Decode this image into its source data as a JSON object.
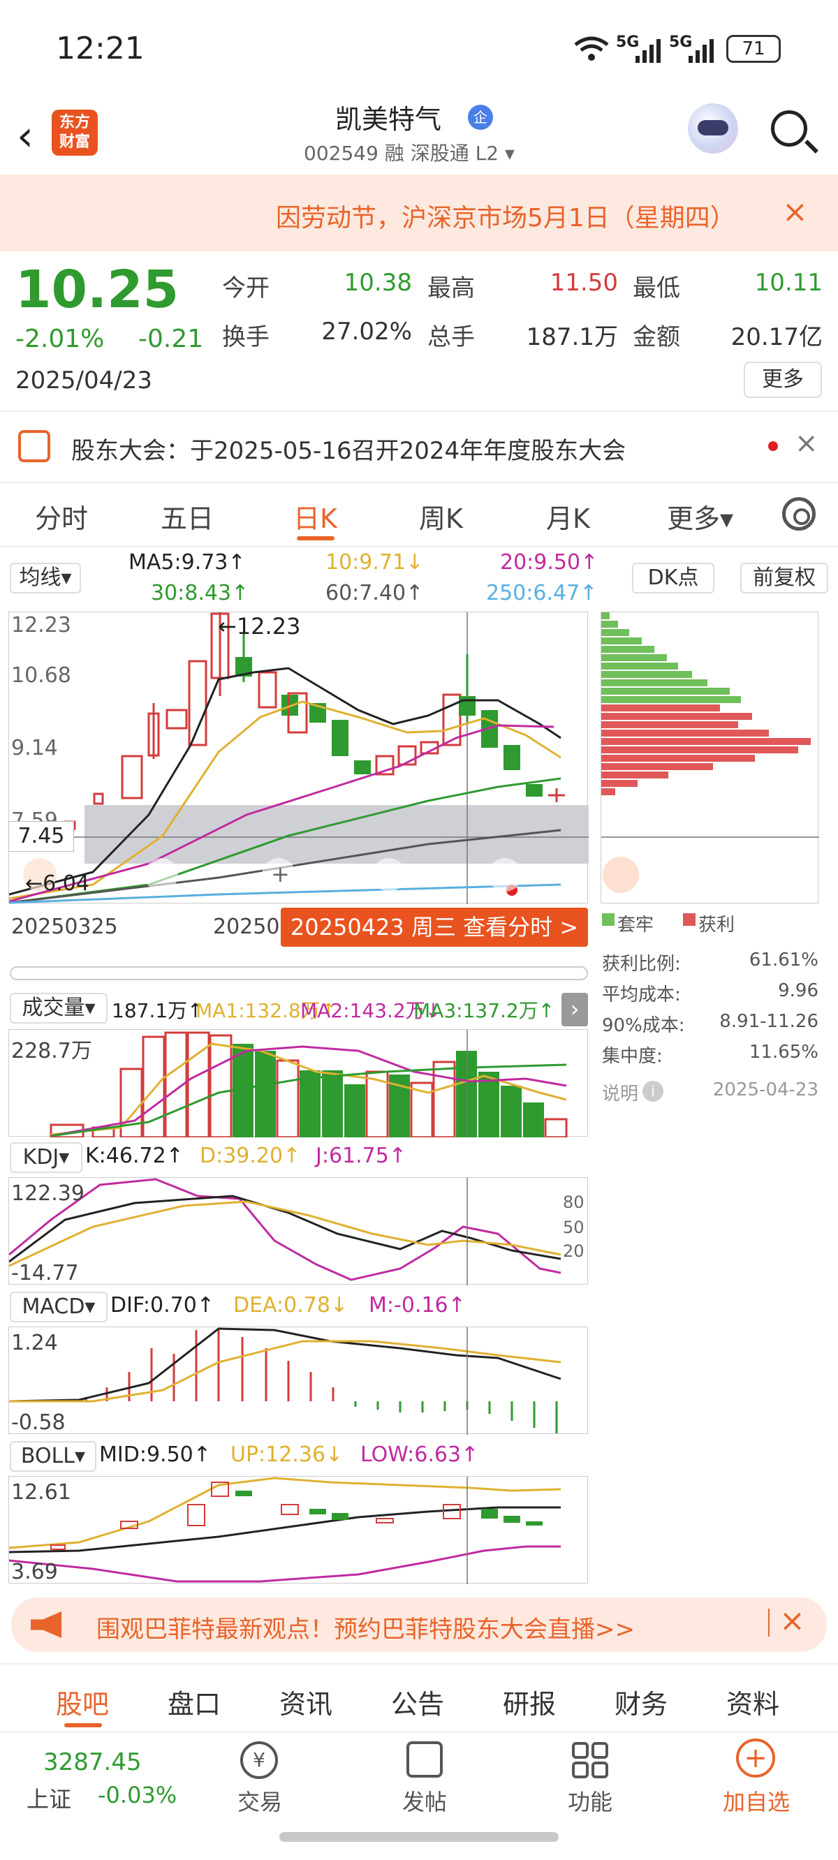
{
  "status": {
    "time": "12:21",
    "net1": "5G",
    "net2": "5G",
    "battery": "71"
  },
  "header": {
    "logo": "东方\n财富",
    "name": "凯美特气",
    "badge": "企",
    "sub": "002549 融 深股通 L2 ▾"
  },
  "notice": {
    "text": "因劳动节，沪深京市场5月1日（星期四）",
    "close": "×"
  },
  "quote": {
    "price": "10.25",
    "pct": "-2.01%",
    "chg": "-0.21",
    "date": "2025/04/23",
    "open_l": "今开",
    "open": "10.38",
    "high_l": "最高",
    "high": "11.50",
    "low_l": "最低",
    "low": "10.11",
    "turn_l": "换手",
    "turn": "27.02%",
    "vol_l": "总手",
    "vol": "187.1万",
    "amt_l": "金额",
    "amt": "20.17亿",
    "more": "更多"
  },
  "meeting": {
    "text": "股东大会：于2025-05-16召开2024年年度股东大会",
    "close": "×"
  },
  "ktabs": [
    "分时",
    "五日",
    "日K",
    "周K",
    "月K",
    "更多▾"
  ],
  "ma": {
    "btn": "均线▾",
    "ma5": "MA5:9.73↑",
    "ma10": "10:9.71↓",
    "ma20": "20:9.50↑",
    "ma30": "30:8.43↑",
    "ma60": "60:7.40↑",
    "ma250": "250:6.47↑",
    "dk": "DK点",
    "fq": "前复权"
  },
  "kchart": {
    "y1": "12.23",
    "y2": "10.68",
    "y3": "9.14",
    "y4": "7.59",
    "y5": "6.04",
    "max_label": "←12.23",
    "cross": "7.45",
    "min_label": "←6.04",
    "d1": "20250325",
    "d2": "20250",
    "tip": "20250423 周三 查看分时 >"
  },
  "chips": {
    "legend1": "套牢",
    "legend2": "获利",
    "rows": [
      {
        "k": "获利比例:",
        "v": "61.61%"
      },
      {
        "k": "平均成本:",
        "v": "9.96"
      },
      {
        "k": "90%成本:",
        "v": "8.91-11.26"
      },
      {
        "k": "集中度:",
        "v": "11.65%"
      }
    ],
    "note": "说明",
    "date": "2025-04-23"
  },
  "vol_panel": {
    "btn": "成交量▾",
    "val": "187.1万↑",
    "ma1": "MA1:132.8万↑",
    "ma2": "MA2:143.2万↓",
    "ma3": "MA3:137.2万↑",
    "top": "228.7万"
  },
  "kdj": {
    "btn": "KDJ▾",
    "k": "K:46.72↑",
    "d": "D:39.20↑",
    "j": "J:61.75↑",
    "top": "122.39",
    "bot": "-14.77",
    "l80": "80",
    "l50": "50",
    "l20": "20"
  },
  "macd": {
    "btn": "MACD▾",
    "dif": "DIF:0.70↑",
    "dea": "DEA:0.78↓",
    "m": "M:-0.16↑",
    "top": "1.24",
    "bot": "-0.58"
  },
  "boll": {
    "btn": "BOLL▾",
    "mid": "MID:9.50↑",
    "up": "UP:12.36↓",
    "low": "LOW:6.63↑",
    "top": "12.61",
    "bot": "3.69"
  },
  "ad": {
    "text": "围观巴菲特最新观点！预约巴菲特股东大会直播>>",
    "close": "×"
  },
  "btabs": [
    "股吧",
    "盘口",
    "资讯",
    "公告",
    "研报",
    "财务",
    "资料"
  ],
  "footer": {
    "index_val": "3287.45",
    "index_name": "上证",
    "index_chg": "-0.03%",
    "trade": "交易",
    "post": "发帖",
    "func": "功能",
    "add": "加自选"
  },
  "colors": {
    "up": "#d43b3b",
    "down": "#2f9a2f",
    "accent": "#e8642b"
  }
}
